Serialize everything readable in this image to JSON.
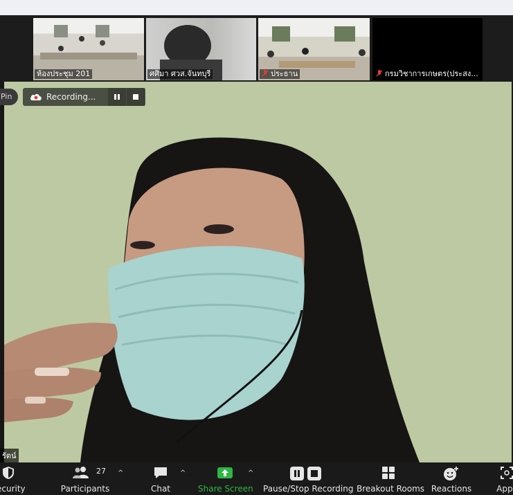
{
  "gallery": [
    {
      "name": "ห้องประชุม 201",
      "muted": false
    },
    {
      "name": "ศศิมา ศวส.จันทบุรี",
      "muted": false
    },
    {
      "name": "ประธาน",
      "muted": true
    },
    {
      "name": "กรมวิชาการเกษตร(ประสง...",
      "muted": true
    }
  ],
  "overlay": {
    "pin_label": "Pin",
    "recording_label": "Recording..."
  },
  "active_speaker": {
    "name": "รัตน์"
  },
  "toolbar": {
    "security": "Security",
    "participants": "Participants",
    "participants_count": "27",
    "chat": "Chat",
    "share_screen": "Share Screen",
    "record": "Pause/Stop Recording",
    "breakout": "Breakout Rooms",
    "reactions": "Reactions",
    "apps": "Apps"
  },
  "colors": {
    "share_green": "#2eb645",
    "video_bg": "#bdc9a2",
    "toolbar_bg": "#1a1a1a"
  }
}
